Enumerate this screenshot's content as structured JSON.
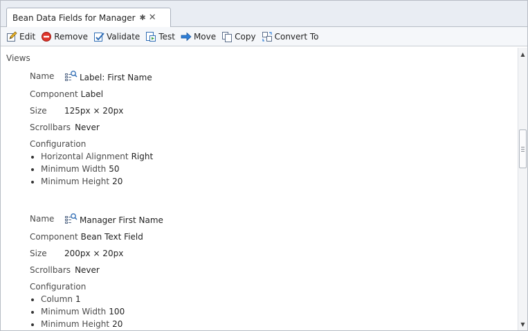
{
  "tab": {
    "title": "Bean Data Fields for Manager",
    "pin_glyph": "✱",
    "close_glyph": "✕"
  },
  "toolbar": {
    "buttons": [
      {
        "label": "Edit",
        "icon": "edit-icon"
      },
      {
        "label": "Remove",
        "icon": "remove-icon"
      },
      {
        "label": "Validate",
        "icon": "validate-icon"
      },
      {
        "label": "Test",
        "icon": "test-icon"
      },
      {
        "label": "Move",
        "icon": "move-arrow-icon"
      },
      {
        "label": "Copy",
        "icon": "copy-icon"
      },
      {
        "label": "Convert To",
        "icon": "convert-icon"
      }
    ]
  },
  "views_heading": "Views",
  "entries": [
    {
      "name_label": "Name",
      "name_value": "Label: First Name",
      "component_label": "Component",
      "component_value": "Label",
      "size_label": "Size",
      "size_value": "125px × 20px",
      "scrollbars_label": "Scrollbars",
      "scrollbars_value": "Never",
      "configuration_label": "Configuration",
      "config": [
        {
          "key": "Horizontal Alignment",
          "value": "Right"
        },
        {
          "key": "Minimum Width",
          "value": "50"
        },
        {
          "key": "Minimum Height",
          "value": "20"
        }
      ]
    },
    {
      "name_label": "Name",
      "name_value": "Manager First Name",
      "component_label": "Component",
      "component_value": "Bean Text Field",
      "size_label": "Size",
      "size_value": "200px × 20px",
      "scrollbars_label": "Scrollbars",
      "scrollbars_value": "Never",
      "configuration_label": "Configuration",
      "config": [
        {
          "key": "Column",
          "value": "1"
        },
        {
          "key": "Minimum Width",
          "value": "100"
        },
        {
          "key": "Minimum Height",
          "value": "20"
        }
      ]
    }
  ],
  "scrollbar": {
    "up_glyph": "▲",
    "down_glyph": "▼",
    "position": 0.4
  }
}
